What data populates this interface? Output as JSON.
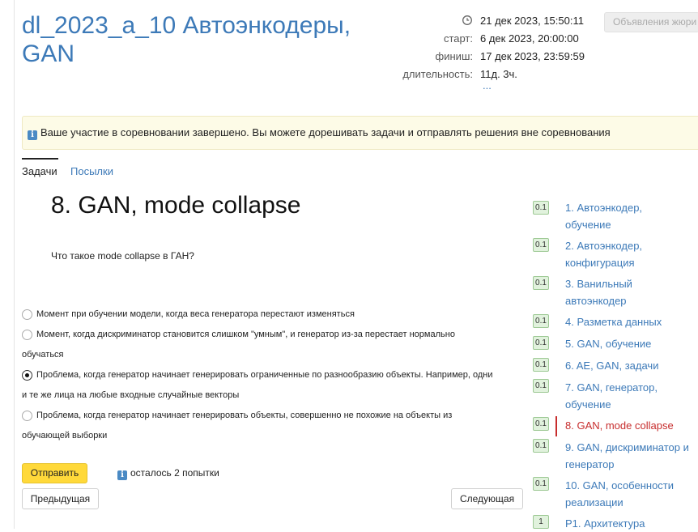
{
  "contest": {
    "title": "dl_2023_a_10 Автоэнкодеры, GAN",
    "current_time": "21 дек 2023, 15:50:11",
    "start_label": "старт:",
    "start_value": "6 дек 2023, 20:00:00",
    "finish_label": "финиш:",
    "finish_value": "17 дек 2023, 23:59:59",
    "duration_label": "длительность:",
    "duration_value": "11д. 3ч.",
    "more": "...",
    "jury_button": "Объявления жюри"
  },
  "notice": "Ваше участие в соревновании завершено. Вы можете дорешивать задачи и отправлять решения вне соревнования",
  "tabs": {
    "tasks": "Задачи",
    "submissions": "Посылки"
  },
  "problem": {
    "title": "8. GAN, mode collapse",
    "question": "Что такое mode collapse в ГАН?",
    "options": [
      {
        "line1": "Момент при обучении модели, когда веса генератора перестают изменяться",
        "line2": "",
        "checked": false
      },
      {
        "line1": "Момент, когда дискриминатор становится слишком \"умным\", и генератор из-за перестает нормально",
        "line2": "обучаться",
        "checked": false
      },
      {
        "line1": "Проблема, когда генератор начинает генерировать ограниченные по разнообразию объекты. Например, одни",
        "line2": "и те же лица на любые входные случайные векторы",
        "checked": true
      },
      {
        "line1": "Проблема, когда генератор начинает генерировать объекты, совершенно не похожие на объекты из",
        "line2": "обучающей выборки",
        "checked": false
      }
    ],
    "submit": "Отправить",
    "attempts": "осталось 2 попытки",
    "prev": "Предыдущая",
    "next": "Следующая"
  },
  "tasks": [
    {
      "badge": "0.1",
      "line1": "1. Автоэнкодер,",
      "line2": "обучение",
      "active": false
    },
    {
      "badge": "0.1",
      "line1": "2. Автоэнкодер,",
      "line2": "конфигурация",
      "active": false
    },
    {
      "badge": "0.1",
      "line1": "3. Ванильный",
      "line2": "автоэнкодер",
      "active": false
    },
    {
      "badge": "0.1",
      "line1": "4. Разметка данных",
      "line2": "",
      "active": false
    },
    {
      "badge": "0.1",
      "line1": "5. GAN, обучение",
      "line2": "",
      "active": false
    },
    {
      "badge": "0.1",
      "line1": "6. AE, GAN, задачи",
      "line2": "",
      "active": false
    },
    {
      "badge": "0.1",
      "line1": "7. GAN, генератор,",
      "line2": "обучение",
      "active": false
    },
    {
      "badge": "0.1",
      "line1": "8. GAN, mode collapse",
      "line2": "",
      "active": true
    },
    {
      "badge": "0.1",
      "line1": "9. GAN, дискриминатор и",
      "line2": "генератор",
      "active": false
    },
    {
      "badge": "0.1",
      "line1": "10. GAN, особенности",
      "line2": "реализации",
      "active": false
    },
    {
      "badge": "1",
      "line1": "P1. Архитектура",
      "line2": "",
      "active": false
    }
  ],
  "colors": {
    "accent": "#3d7ab8",
    "active_task": "#c72d2d",
    "submit_button": "#ffd93a",
    "notice_background": "#fdfbe7",
    "badge_background": "#e1f2dd"
  },
  "icons": {
    "clock": "clock-icon",
    "info": "info-icon"
  }
}
